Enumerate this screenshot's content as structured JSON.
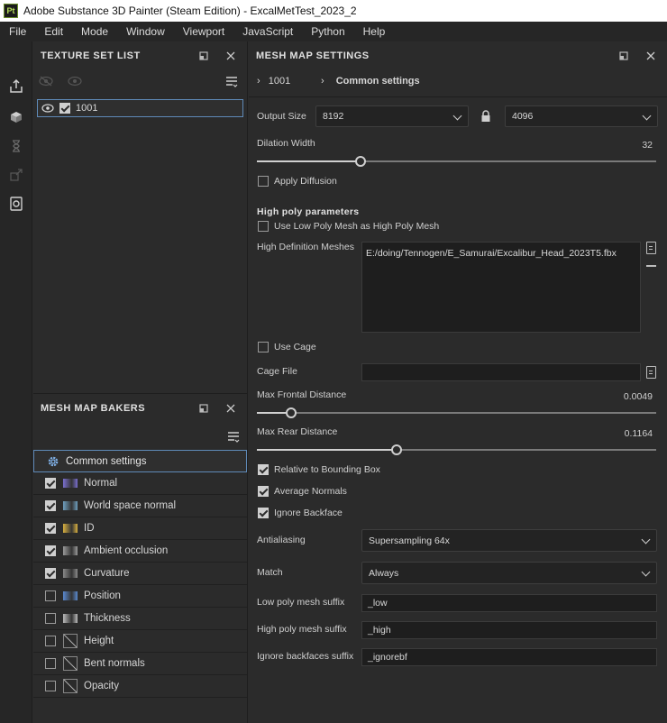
{
  "window": {
    "title": "Adobe Substance 3D Painter (Steam Edition) - ExcalMetTest_2023_2",
    "badge": "Pt"
  },
  "menu": [
    "File",
    "Edit",
    "Mode",
    "Window",
    "Viewport",
    "JavaScript",
    "Python",
    "Help"
  ],
  "texture_set_list": {
    "title": "TEXTURE SET LIST",
    "items": [
      {
        "label": "1001",
        "checked": true,
        "visible": true
      }
    ]
  },
  "mesh_map_bakers": {
    "title": "MESH MAP BAKERS",
    "common": "Common settings",
    "items": [
      {
        "label": "Normal",
        "checked": true,
        "thumb": "#7a6fd0"
      },
      {
        "label": "World space normal",
        "checked": true,
        "thumb": "#6fa0c0"
      },
      {
        "label": "ID",
        "checked": true,
        "thumb": "#d8b040"
      },
      {
        "label": "Ambient occlusion",
        "checked": true,
        "thumb": "#9a9a9a"
      },
      {
        "label": "Curvature",
        "checked": true,
        "thumb": "#8a8a8a"
      },
      {
        "label": "Position",
        "checked": false,
        "thumb": "#5a8ad0"
      },
      {
        "label": "Thickness",
        "checked": false,
        "thumb": "#bbbbbb"
      },
      {
        "label": "Height",
        "checked": false,
        "thumb": "none"
      },
      {
        "label": "Bent normals",
        "checked": false,
        "thumb": "none"
      },
      {
        "label": "Opacity",
        "checked": false,
        "thumb": "none"
      }
    ]
  },
  "mesh_map_settings": {
    "title": "MESH MAP SETTINGS",
    "crumb_set": "1001",
    "crumb_section": "Common settings",
    "output_size_label": "Output Size",
    "output_size_w": "8192",
    "output_size_h": "4096",
    "dilation_label": "Dilation Width",
    "dilation_value": "32",
    "dilation_fraction": 0.26,
    "apply_diffusion": "Apply Diffusion",
    "high_poly_title": "High poly parameters",
    "use_low_poly": "Use Low Poly Mesh as High Poly Mesh",
    "hd_meshes_label": "High Definition Meshes",
    "hd_mesh_path": "E:/doing/Tennogen/E_Samurai/Excalibur_Head_2023T5.fbx",
    "use_cage": "Use Cage",
    "cage_file_label": "Cage File",
    "cage_file_value": "",
    "max_frontal_label": "Max Frontal Distance",
    "max_frontal_value": "0.0049",
    "max_frontal_fraction": 0.085,
    "max_rear_label": "Max Rear Distance",
    "max_rear_value": "0.1164",
    "max_rear_fraction": 0.35,
    "relative_bbox": "Relative to Bounding Box",
    "average_normals": "Average Normals",
    "ignore_backface": "Ignore Backface",
    "antialiasing_label": "Antialiasing",
    "antialiasing_value": "Supersampling 64x",
    "match_label": "Match",
    "match_value": "Always",
    "low_suffix_label": "Low poly mesh suffix",
    "low_suffix_value": "_low",
    "high_suffix_label": "High poly mesh suffix",
    "high_suffix_value": "_high",
    "ignore_suffix_label": "Ignore backfaces suffix",
    "ignore_suffix_value": "_ignorebf"
  }
}
